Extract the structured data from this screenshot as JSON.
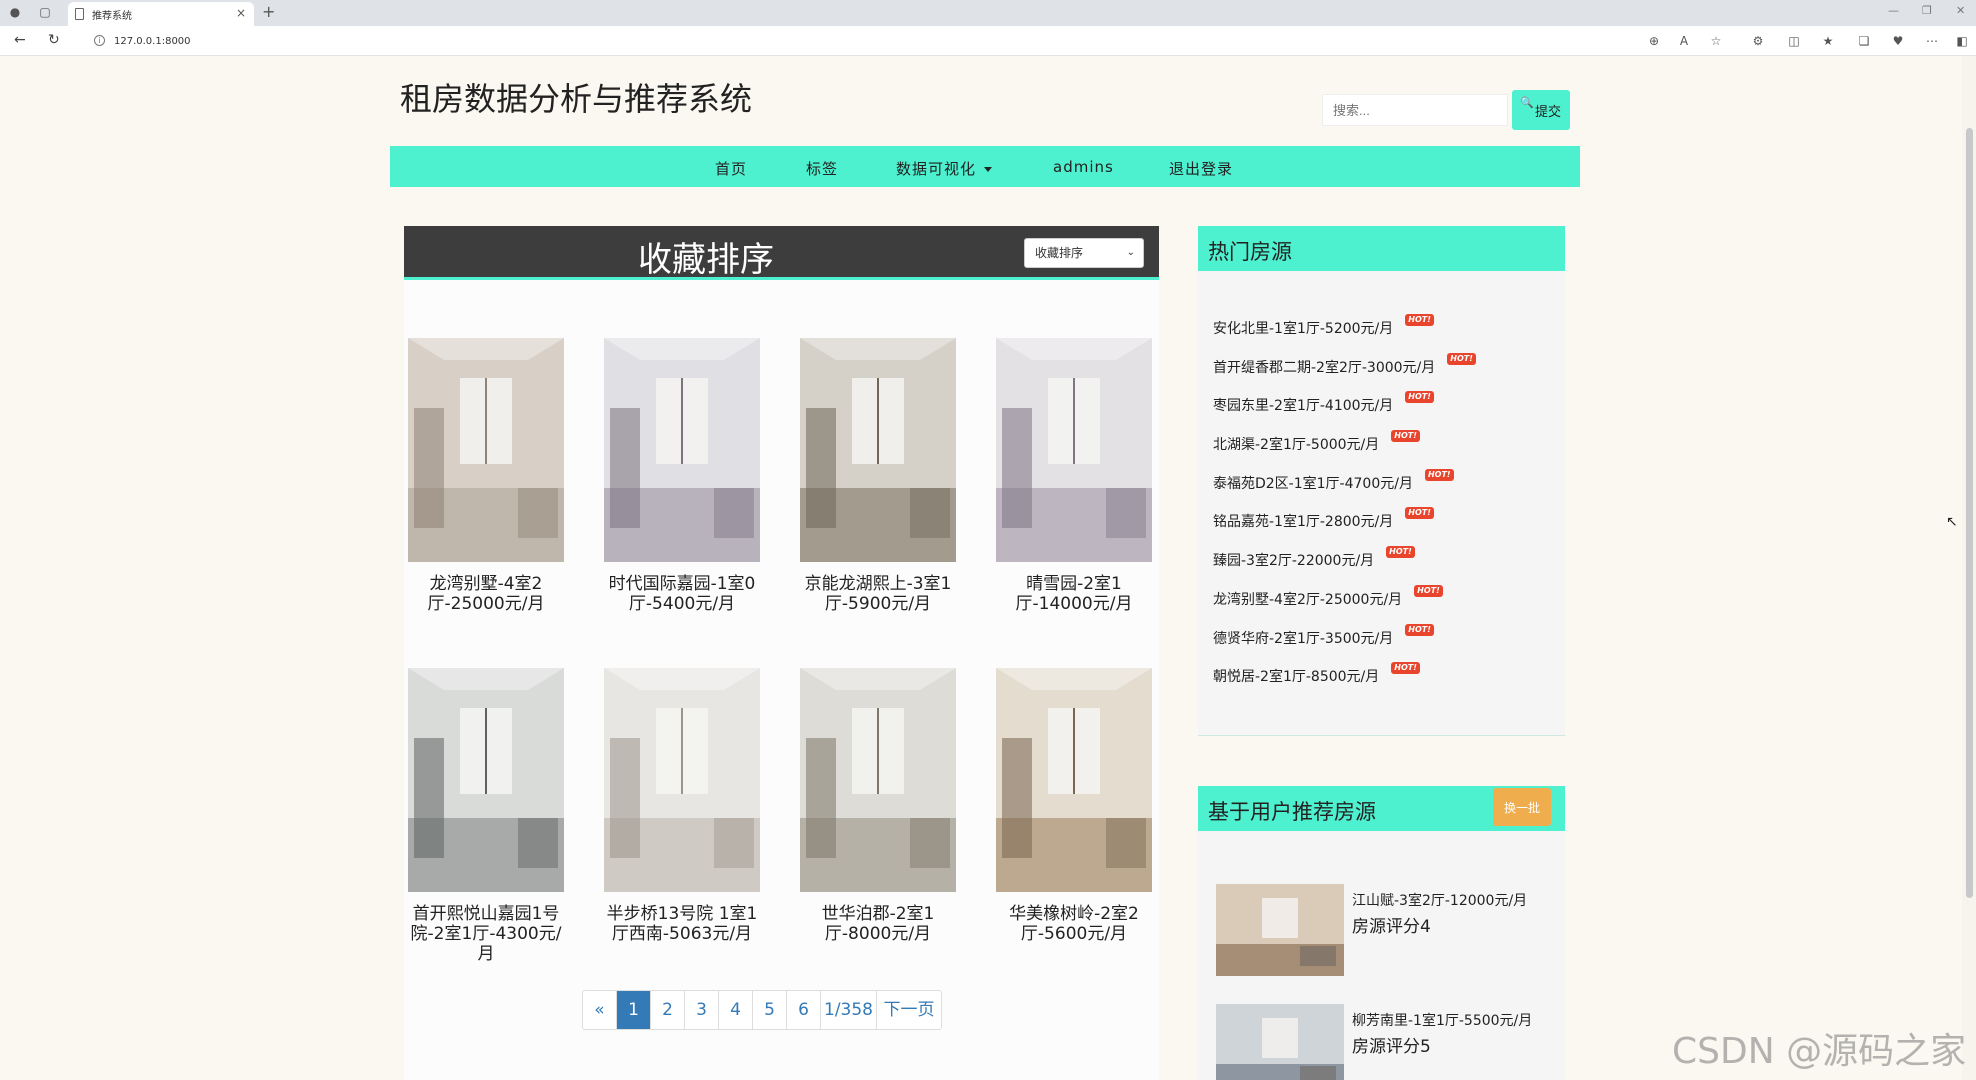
{
  "browser": {
    "tab_title": "推荐系统",
    "url": "127.0.0.1:8000"
  },
  "site": {
    "title": "租房数据分析与推荐系统",
    "search_placeholder": "搜索...",
    "search_button": "提交"
  },
  "nav": {
    "items": [
      "首页",
      "标签",
      "数据可视化",
      "admins",
      "退出登录"
    ]
  },
  "main": {
    "title": "收藏排序",
    "sort_selected": "收藏排序",
    "listings": [
      {
        "caption": "龙湾别墅-4室2厅-25000元/月",
        "palette": [
          "#d8d0c6",
          "#bfb6ac",
          "#8f8276"
        ]
      },
      {
        "caption": "时代国际嘉园-1室0厅-5400元/月",
        "palette": [
          "#e0dfe3",
          "#b8b2bc",
          "#7c7280"
        ]
      },
      {
        "caption": "京能龙湖熙上-3室1厅-5900元/月",
        "palette": [
          "#d5d0c8",
          "#a39b8e",
          "#6d6659"
        ]
      },
      {
        "caption": "晴雪园-2室1厅-14000元/月",
        "palette": [
          "#e3e1e4",
          "#bdb6c0",
          "#7f7584"
        ]
      },
      {
        "caption": "首开熙悦山嘉园1号院-2室1厅-4300元/月",
        "palette": [
          "#d9dbd9",
          "#a7aaa8",
          "#5f6260"
        ]
      },
      {
        "caption": "半步桥13号院 1室1厅西南-5063元/月",
        "palette": [
          "#e8e6e3",
          "#cfcac4",
          "#9b948c"
        ]
      },
      {
        "caption": "世华泊郡-2室1厅-8000元/月",
        "palette": [
          "#dedcd6",
          "#b6b1a6",
          "#7d7669"
        ]
      },
      {
        "caption": "华美橡树岭-2室2厅-5600元/月",
        "palette": [
          "#e4dccf",
          "#bca990",
          "#7a6550"
        ]
      }
    ],
    "pagination": [
      "«",
      "1",
      "2",
      "3",
      "4",
      "5",
      "6",
      "1/358",
      "下一页"
    ],
    "active_page": "1"
  },
  "sidebar": {
    "hot_title": "热门房源",
    "hot_badge": "HOT!",
    "hot_items": [
      "安化北里-1室1厅-5200元/月",
      "首开缇香郡二期-2室2厅-3000元/月",
      "枣园东里-2室1厅-4100元/月",
      "北湖渠-2室1厅-5000元/月",
      "泰福苑D2区-1室1厅-4700元/月",
      "铭品嘉苑-1室1厅-2800元/月",
      "臻园-3室2厅-22000元/月",
      "龙湾别墅-4室2厅-25000元/月",
      "德贤华府-2室1厅-3500元/月",
      "朝悦居-2室1厅-8500元/月"
    ],
    "rec_title": "基于用户推荐房源",
    "rec_refresh": "换一批",
    "rec_items": [
      {
        "title": "江山赋-3室2厅-12000元/月",
        "score": "房源评分4"
      },
      {
        "title": "柳芳南里-1室1厅-5500元/月",
        "score": "房源评分5"
      }
    ]
  },
  "watermark": "CSDN @源码之家",
  "colors": {
    "accent": "#4df0cf",
    "panel_header": "#3d3d3d",
    "hot_badge": "#e8452c",
    "refresh": "#f0ad4e",
    "page_active": "#337ab7",
    "page_bg": "#fbf8f1"
  }
}
